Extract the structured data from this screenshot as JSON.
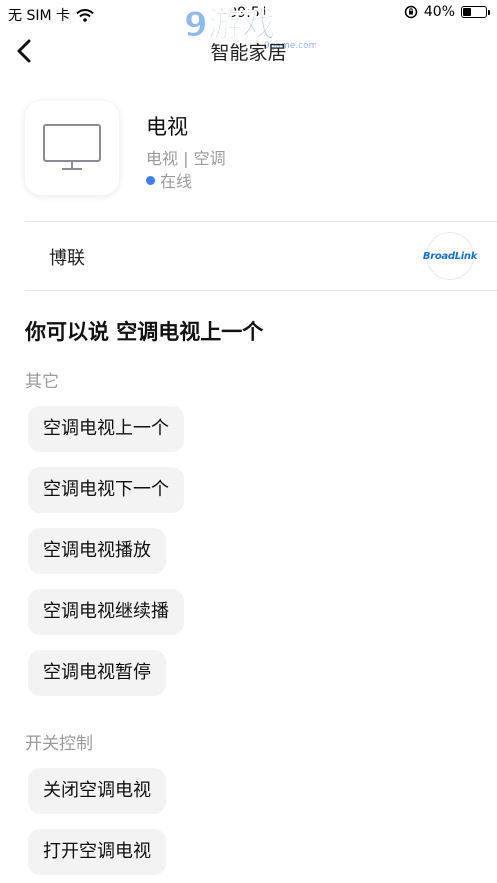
{
  "status_bar": {
    "carrier": "无 SIM 卡",
    "time": "09:51",
    "battery_percent": "40%",
    "battery_level": 0.4
  },
  "watermark": {
    "text": "9游戏",
    "subtext": "9game.com"
  },
  "nav": {
    "title": "智能家居"
  },
  "device": {
    "name": "电视",
    "category": "电视 | 空调",
    "status": "在线",
    "status_color": "#3d7cf2"
  },
  "brand": {
    "name": "博联",
    "logo_text": "BroadLink"
  },
  "suggestions": {
    "title": "你可以说 空调电视上一个",
    "sections": [
      {
        "label": "其它",
        "items": [
          "空调电视上一个",
          "空调电视下一个",
          "空调电视播放",
          "空调电视继续播",
          "空调电视暂停"
        ]
      },
      {
        "label": "开关控制",
        "items": [
          "关闭空调电视",
          "打开空调电视"
        ]
      }
    ]
  }
}
